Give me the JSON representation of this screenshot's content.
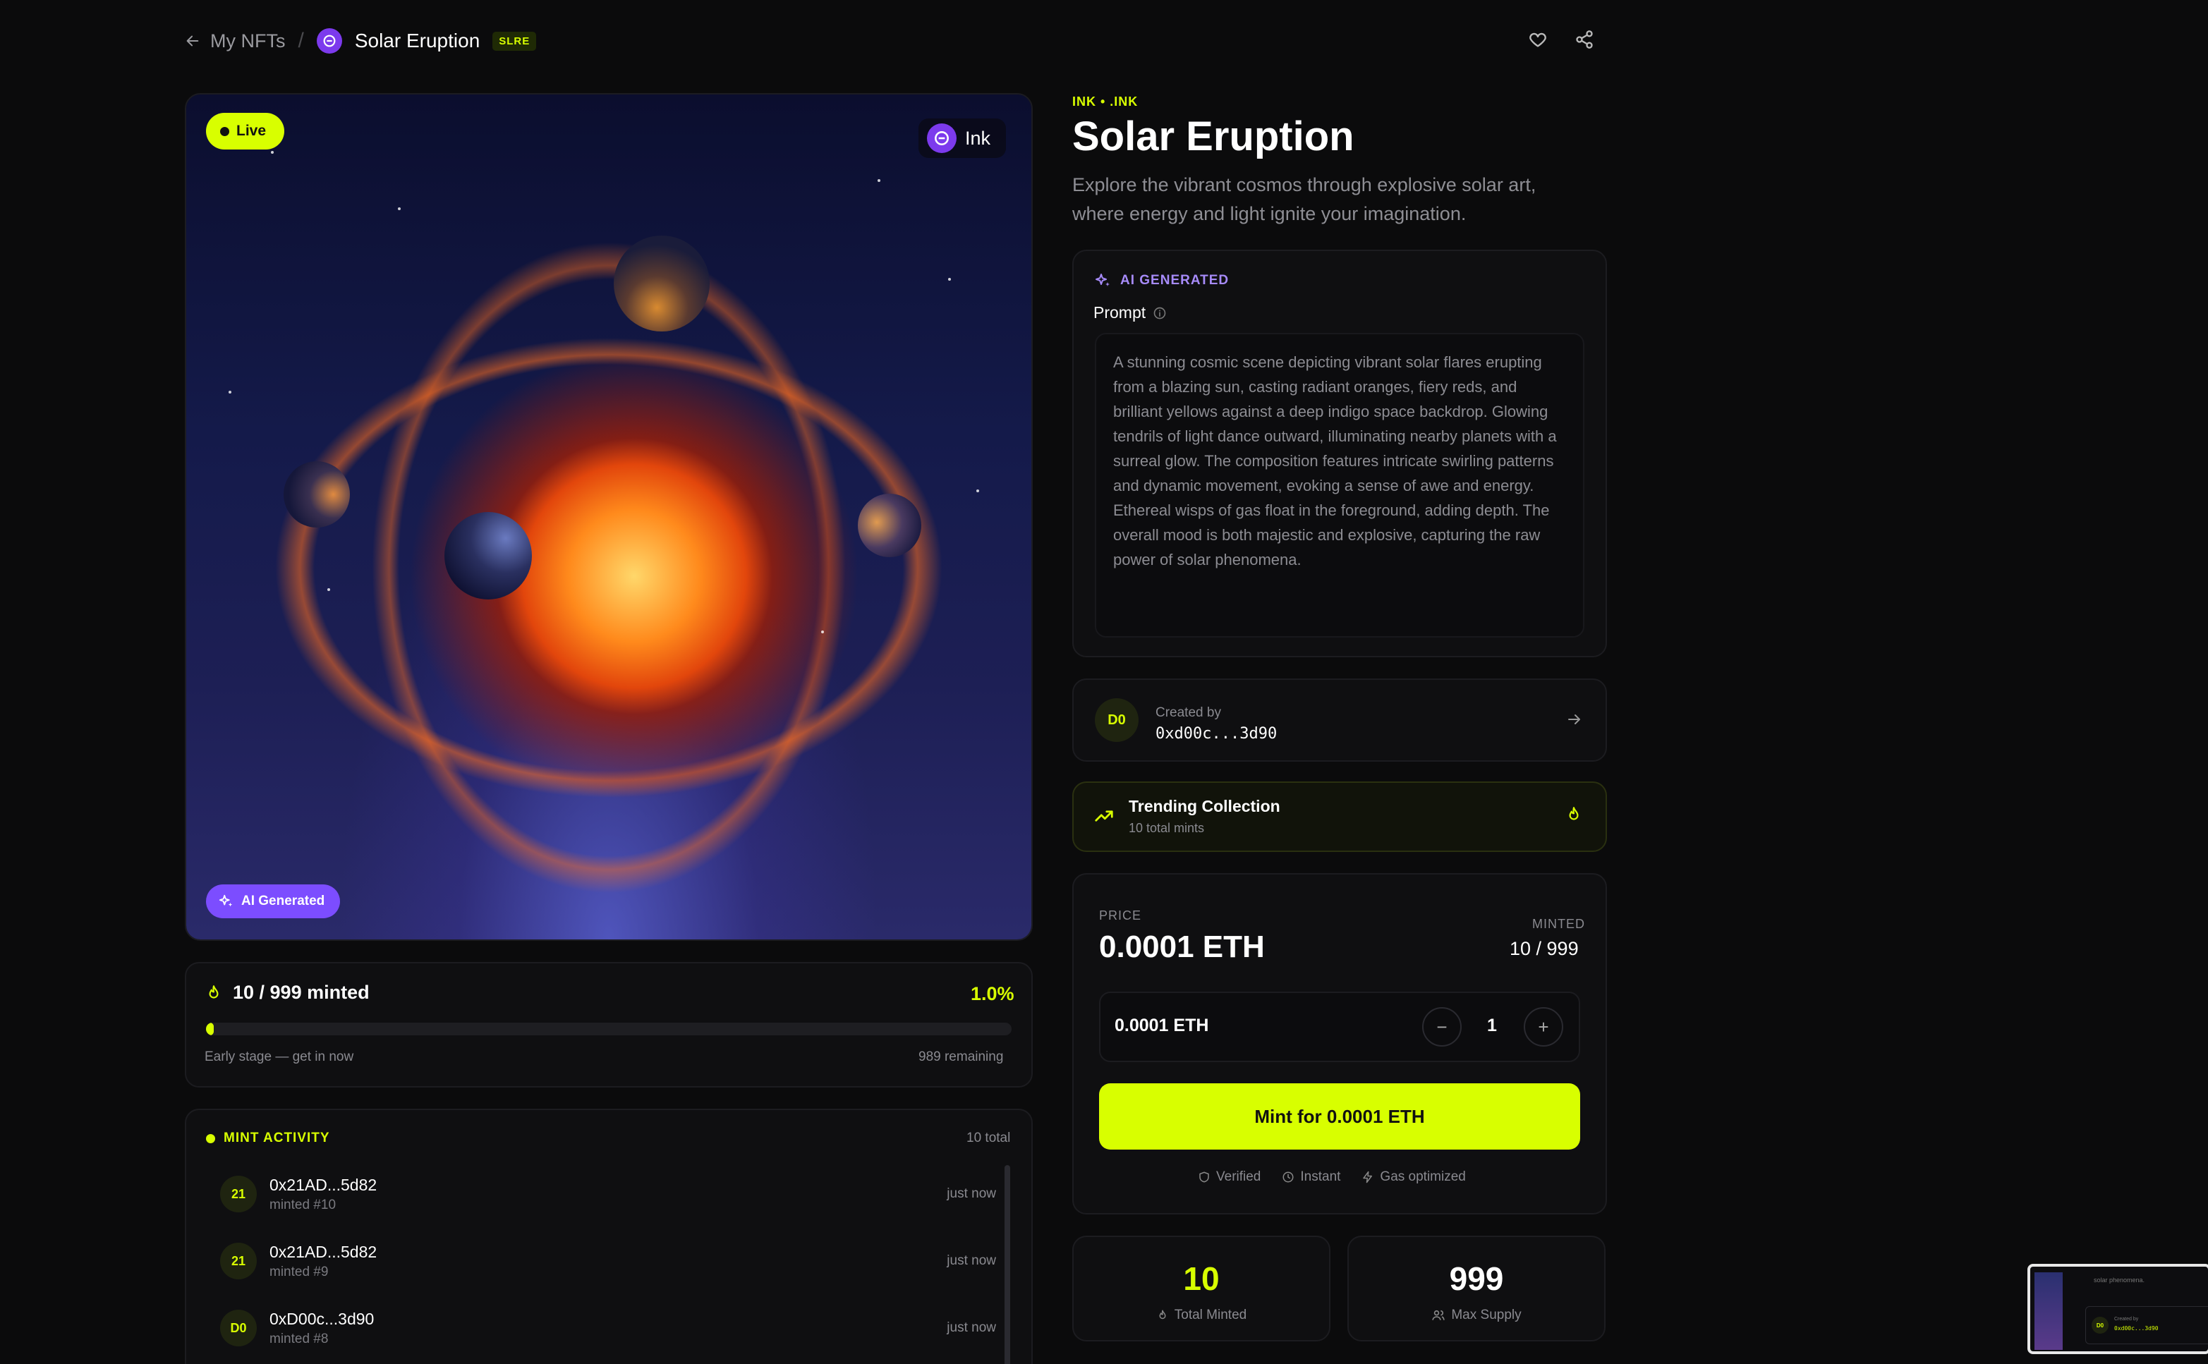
{
  "nav": {
    "back_label": "My NFTs",
    "separator": "/",
    "collection_name": "Solar Eruption",
    "ticker": "SLRE"
  },
  "hero": {
    "live_label": "Live",
    "chain_label": "Ink",
    "ai_badge": "AI Generated"
  },
  "progress": {
    "title": "10 / 999 minted",
    "percent_label": "1.0%",
    "percent": 0.01,
    "note": "Early stage — get in now",
    "remaining": "989 remaining"
  },
  "activity": {
    "heading": "MINT ACTIVITY",
    "total": "10 total",
    "rows": [
      {
        "avatar": "21",
        "address": "0x21AD...5d82",
        "sub": "minted #10",
        "time": "just now"
      },
      {
        "avatar": "21",
        "address": "0x21AD...5d82",
        "sub": "minted #9",
        "time": "just now"
      },
      {
        "avatar": "D0",
        "address": "0xD00c...3d90",
        "sub": "minted #8",
        "time": "just now"
      }
    ]
  },
  "details": {
    "collection_tag": "INK • .INK",
    "title": "Solar Eruption",
    "description": "Explore the vibrant cosmos through explosive solar art, where energy and light ignite your imagination."
  },
  "prompt": {
    "ai_label": "AI GENERATED",
    "label": "Prompt",
    "text": "A stunning cosmic scene depicting vibrant solar flares erupting from a blazing sun, casting radiant oranges, fiery reds, and brilliant yellows against a deep indigo space backdrop. Glowing tendrils of light dance outward, illuminating nearby planets with a surreal glow. The composition features intricate swirling patterns and dynamic movement, evoking a sense of awe and energy. Ethereal wisps of gas float in the foreground, adding depth. The overall mood is both majestic and explosive, capturing the raw power of solar phenomena."
  },
  "creator": {
    "avatar": "D0",
    "label": "Created by",
    "address": "0xd00c...3d90"
  },
  "trending": {
    "title": "Trending Collection",
    "subtitle": "10 total mints"
  },
  "price": {
    "price_label": "PRICE",
    "price_value": "0.0001 ETH",
    "minted_label": "MINTED",
    "minted_value": "10 / 999",
    "qty_price": "0.0001 ETH",
    "decrement": "−",
    "quantity": "1",
    "increment": "+",
    "mint_button": "Mint for 0.0001 ETH",
    "badges": [
      "Verified",
      "Instant",
      "Gas optimized"
    ]
  },
  "stats": {
    "total_minted_value": "10",
    "total_minted_label": "Total Minted",
    "max_supply_value": "999",
    "max_supply_label": "Max Supply"
  },
  "mini_preview": {
    "text": "solar phenomena.",
    "creator_label": "Created by",
    "creator_address": "0xd00c...3d90",
    "avatar": "D0"
  },
  "colors": {
    "accent": "#d8ff00",
    "ai_purple": "#7c4dff",
    "background": "#0b0b0c"
  }
}
